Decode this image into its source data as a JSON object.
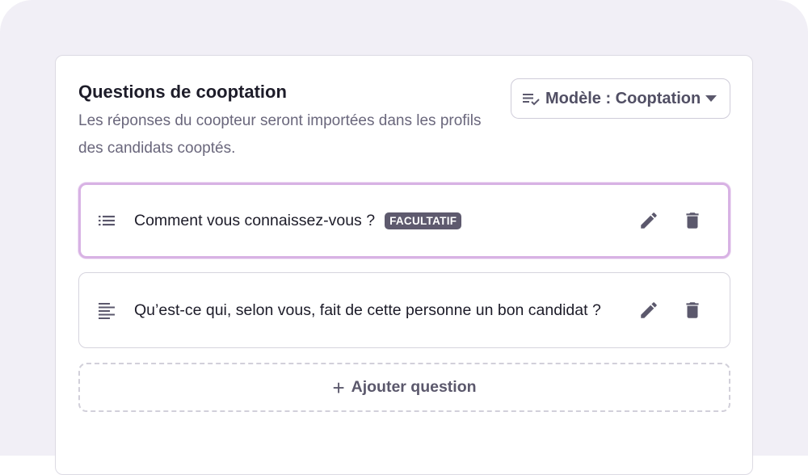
{
  "section": {
    "title": "Questions de cooptation",
    "subtitle": "Les réponses du coopteur seront importées dans les profils des candidats cooptés."
  },
  "template_select": {
    "label": "Modèle : Cooptation",
    "icon": "checklist-icon"
  },
  "questions": [
    {
      "text": "Comment vous connaissez-vous ?",
      "type_icon": "list-icon",
      "badge": "FACULTATIF",
      "selected": true
    },
    {
      "text": "Qu’est-ce qui, selon vous, fait de cette personne un bon candidat ?",
      "type_icon": "paragraph-icon",
      "badge": "",
      "selected": false
    }
  ],
  "add_question": {
    "label": "Ajouter question",
    "icon": "plus-icon"
  },
  "colors": {
    "accent_border": "#d8b2e4",
    "badge_bg": "#5e5a6e",
    "icon": "#5b586c"
  }
}
